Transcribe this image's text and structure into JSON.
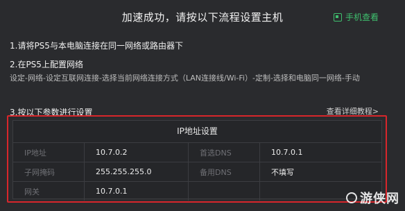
{
  "header": {
    "title": "加速成功，请按以下流程设置主机",
    "mobile_link": "手机查看"
  },
  "steps": [
    {
      "label": "1.请将PS5与本电脑连接在同一网络或路由器下"
    },
    {
      "label": "2.在PS5上配置网络"
    },
    {
      "label": "3.按以下参数进行设置"
    }
  ],
  "step2_desc": "设定-网络-设定互联网连接-选择当前网络连接方式（LAN连接线/Wi-Fi）-定制-选择和电脑同一网络-手动",
  "tutorial_link": "查看详细教程>",
  "ip_panel": {
    "title": "IP地址设置",
    "rows": [
      {
        "label1": "IP地址",
        "value1": "10.7.0.2",
        "label2": "首选DNS",
        "value2": "10.7.0.1"
      },
      {
        "label1": "子网掩码",
        "value1": "255.255.255.0",
        "label2": "备用DNS",
        "value2": "不填写"
      },
      {
        "label1": "网关",
        "value1": "10.7.0.1",
        "label2": "",
        "value2": ""
      }
    ]
  },
  "watermark": "游侠网",
  "colors": {
    "accent_green": "#3fbf6e",
    "highlight_red": "#d8262b",
    "background": "#2a2b2e"
  }
}
